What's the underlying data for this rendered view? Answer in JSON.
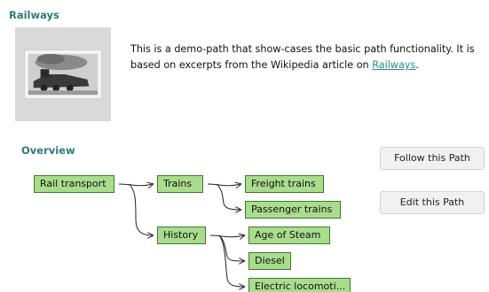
{
  "path": {
    "title": "Railways",
    "description_text": "This is a demo-path that show-cases the basic path functionality. It is based on excerpts from the Wikipedia article on ",
    "description_link": "Railways",
    "description_end": "."
  },
  "overview": {
    "title": "Overview",
    "nodes": {
      "rail_transport": "Rail transport",
      "trains": "Trains",
      "freight_trains": "Freight trains",
      "passenger_trains": "Passenger trains",
      "history": "History",
      "age_of_steam": "Age of Steam",
      "diesel": "Diesel",
      "electric": "Electric locomoti..."
    }
  },
  "actions": {
    "follow": "Follow this Path",
    "edit": "Edit this Path"
  },
  "colors": {
    "heading": "#2b7a78",
    "node_fill": "#a9dc8c",
    "node_border": "#3e7a2e",
    "link": "#2b8a86"
  }
}
